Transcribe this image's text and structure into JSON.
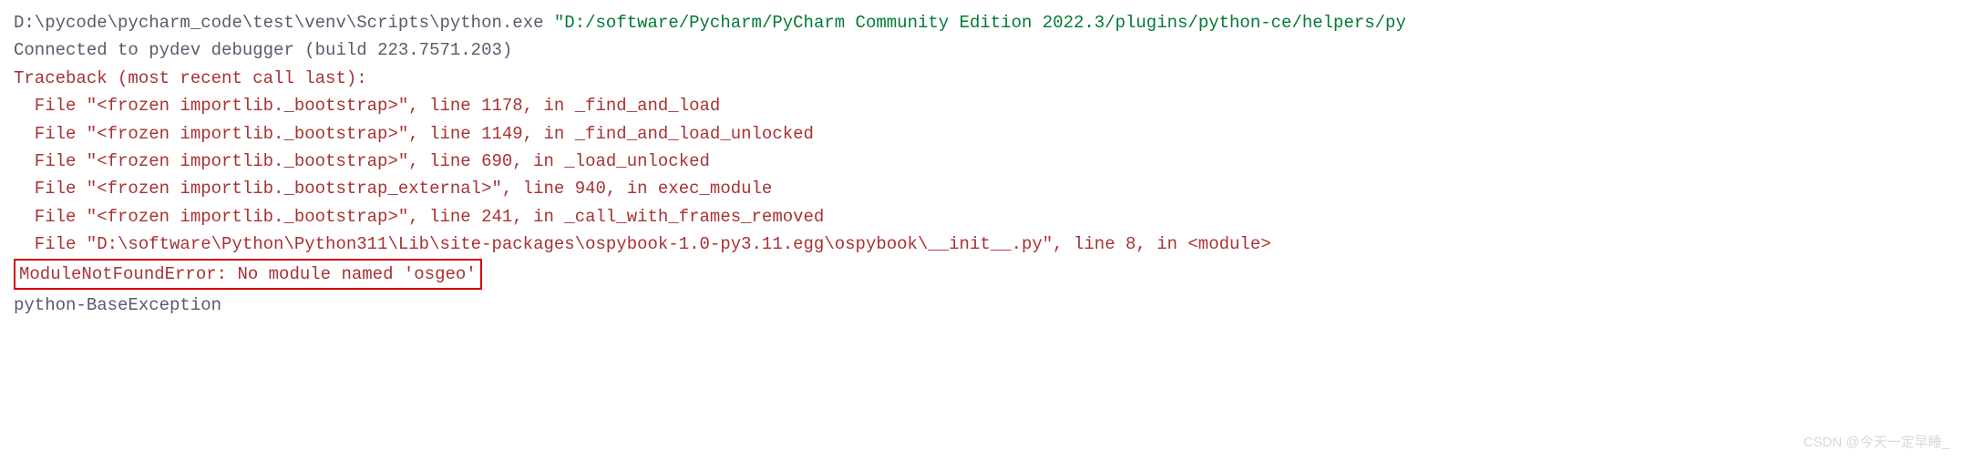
{
  "command": {
    "exe_path": "D:\\pycode\\pycharm_code\\test\\venv\\Scripts\\python.exe",
    "script_arg": "\"D:/software/Pycharm/PyCharm Community Edition 2022.3/plugins/python-ce/helpers/py"
  },
  "debugger_line": "Connected to pydev debugger (build 223.7571.203)",
  "traceback_header": "Traceback (most recent call last):",
  "frames": [
    "File \"<frozen importlib._bootstrap>\", line 1178, in _find_and_load",
    "File \"<frozen importlib._bootstrap>\", line 1149, in _find_and_load_unlocked",
    "File \"<frozen importlib._bootstrap>\", line 690, in _load_unlocked",
    "File \"<frozen importlib._bootstrap_external>\", line 940, in exec_module",
    "File \"<frozen importlib._bootstrap>\", line 241, in _call_with_frames_removed",
    "File \"D:\\software\\Python\\Python311\\Lib\\site-packages\\ospybook-1.0-py3.11.egg\\ospybook\\__init__.py\", line 8, in <module>"
  ],
  "error_line": "ModuleNotFoundError: No module named 'osgeo'",
  "base_exception": "python-BaseException",
  "watermark": "CSDN @今天一定早睡_"
}
